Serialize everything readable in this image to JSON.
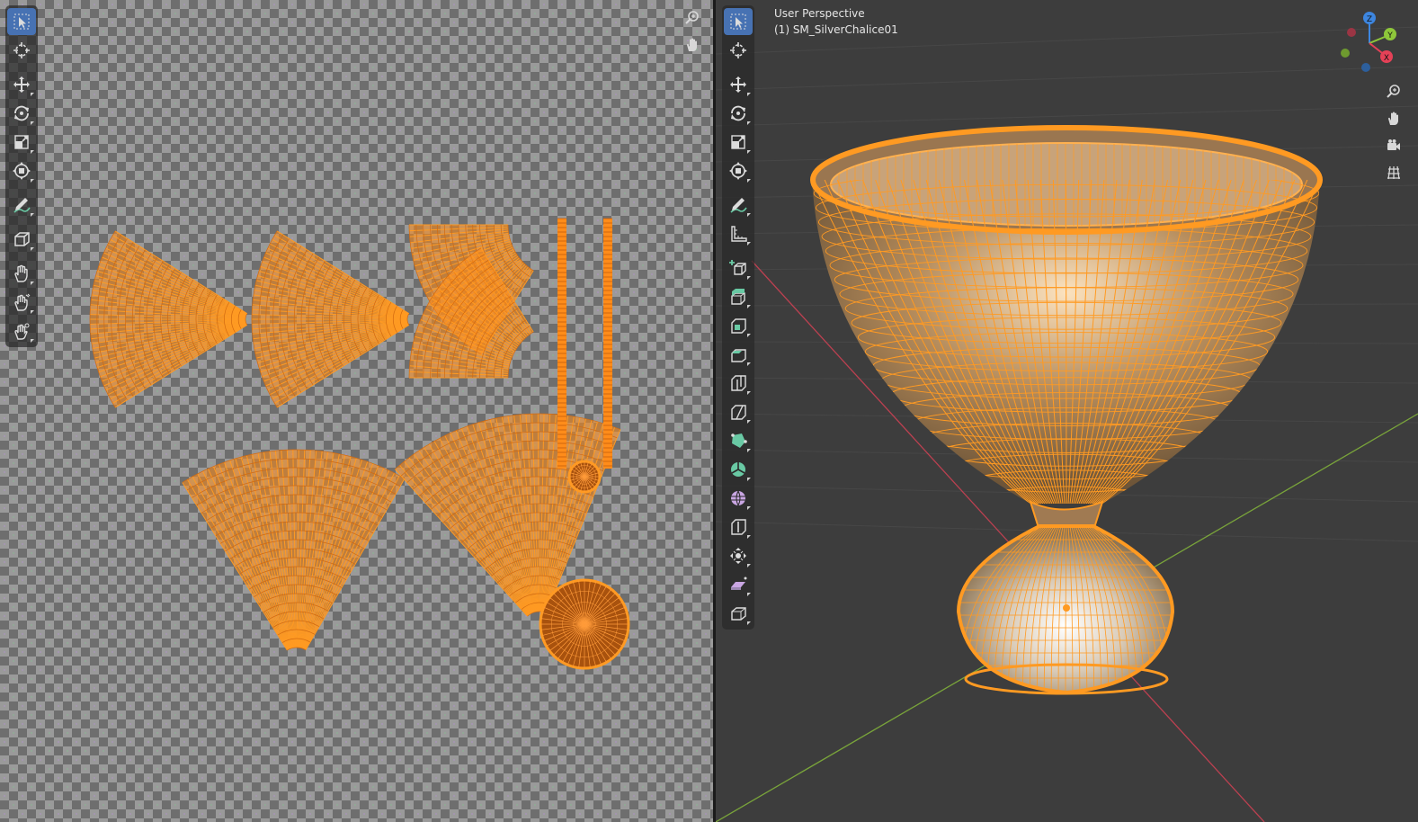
{
  "uv_editor": {
    "toolbar": [
      {
        "icon": "select-box-icon",
        "active": true
      },
      {
        "icon": "cursor-icon",
        "active": false
      },
      {
        "icon": "move-icon",
        "active": false
      },
      {
        "icon": "rotate-icon",
        "active": false
      },
      {
        "icon": "scale-icon",
        "active": false
      },
      {
        "icon": "transform-icon",
        "active": false
      },
      {
        "icon": "annotate-icon",
        "active": false
      },
      {
        "icon": "rip-region-icon",
        "active": false
      },
      {
        "icon": "grab-hand-icon",
        "active": false
      },
      {
        "icon": "relax-hand-icon",
        "active": false
      },
      {
        "icon": "pinch-hand-icon",
        "active": false
      }
    ],
    "nav_buttons": [
      "zoom-icon",
      "pan-hand-icon"
    ]
  },
  "viewport": {
    "title": "User Perspective",
    "object_label": "(1) SM_SilverChalice01",
    "gizmo_axes": {
      "x": "X",
      "y": "Y",
      "z": "Z"
    },
    "colors": {
      "x": "#e54157",
      "y": "#8ec73a",
      "z": "#3d86e0",
      "selection": "#ff9a22"
    },
    "toolbar": [
      {
        "icon": "select-box-icon",
        "active": true
      },
      {
        "icon": "cursor-icon",
        "active": false
      },
      {
        "icon": "move-icon",
        "active": false
      },
      {
        "icon": "rotate-icon",
        "active": false
      },
      {
        "icon": "scale-icon",
        "active": false
      },
      {
        "icon": "transform-icon",
        "active": false
      },
      {
        "icon": "annotate-icon",
        "active": false
      },
      {
        "icon": "measure-icon",
        "active": false
      },
      {
        "icon": "add-cube-icon",
        "active": false
      },
      {
        "icon": "extrude-icon",
        "active": false
      },
      {
        "icon": "inset-icon",
        "active": false
      },
      {
        "icon": "bevel-icon",
        "active": false
      },
      {
        "icon": "loop-cut-icon",
        "active": false
      },
      {
        "icon": "knife-icon",
        "active": false
      },
      {
        "icon": "poly-build-icon",
        "active": false
      },
      {
        "icon": "spin-icon",
        "active": false
      },
      {
        "icon": "smooth-icon",
        "active": false
      },
      {
        "icon": "edge-slide-icon",
        "active": false
      },
      {
        "icon": "shrink-fatten-icon",
        "active": false
      },
      {
        "icon": "shear-icon",
        "active": false
      },
      {
        "icon": "rip-icon",
        "active": false
      }
    ],
    "nav_buttons": [
      "zoom-icon",
      "pan-hand-icon",
      "camera-icon",
      "grid-icon"
    ]
  }
}
